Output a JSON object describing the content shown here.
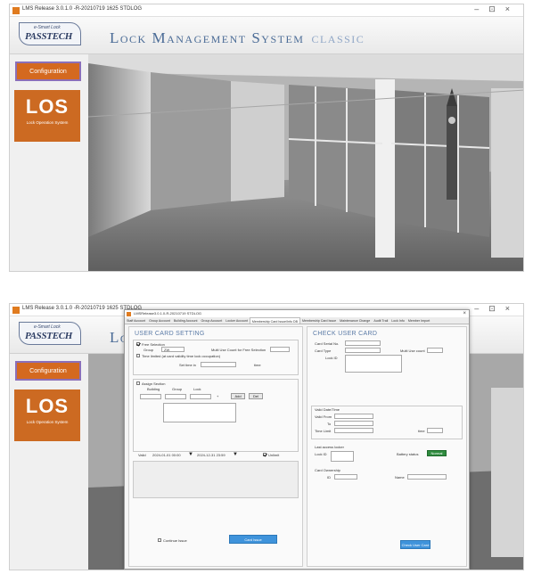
{
  "window": {
    "title": "LMS Release 3.0.1.0 -R-20210719 1625 STDLOG"
  },
  "header": {
    "logo_small": "e-Smart Lock",
    "logo_main": "PASSTECH",
    "app_title": "Lock Management System",
    "edition": "CLASSIC"
  },
  "sidebar": {
    "config_label": "Configuration",
    "los_title": "LOS",
    "los_subtitle": "Lock Operation System"
  },
  "dialog": {
    "title": "LMSRelease3.0.1.0-R-20210719 STDLOG",
    "tabs": [
      "Staff Account",
      "Group Account",
      "Building Account",
      "Group Account",
      "Locker Account",
      "Membership Card Issue/Info DB",
      "Membership Card Issue",
      "Maintenance Change",
      "Audit Trail",
      "Lock Info",
      "Member Import"
    ],
    "active_tab_index": 5,
    "left": {
      "heading": "USER CARD SETTING",
      "free_selection": "Free Selection",
      "group": "Group",
      "group_value": "ZW",
      "multi_use": "Multi Use Count for Free Selection",
      "time_limited": "Time limited (at card validity time lock occupation)",
      "set_time": "Set time in",
      "time_unit": "time",
      "assign_section": "Assign Section",
      "building": "Building",
      "group2": "Group",
      "lock": "Lock",
      "plus": "+",
      "add": "Add",
      "del": "Del",
      "valid": "Valid",
      "valid_from": "2024-01-01 00:00",
      "valid_to": "2024-12-31 23:59",
      "unlimited": "Unlimit",
      "continue_issue": "Continue Issue",
      "card_issue": "Card Issue"
    },
    "right": {
      "heading": "CHECK USER CARD",
      "card_serial": "Card Serial No.",
      "card_type": "Card Type",
      "multi_count": "Multi Use count",
      "lock_id": "Lock ID",
      "valid_date_time": "Valid Date/Time",
      "valid_from": "Valid From",
      "to": "To",
      "time_limit": "Time Limit",
      "time": "time",
      "last_access_lock": "Last access locker",
      "lock_id2": "Lock ID",
      "battery_status": "Battery status",
      "battery_value": "Normal",
      "card_ownership": "Card Ownership",
      "id": "ID",
      "name": "Name",
      "check_user_card": "Check User Card"
    }
  },
  "colors": {
    "accent_orange": "#d4691f",
    "title_blue": "#4a6b96",
    "button_blue": "#3f93db",
    "battery_green": "#2e8b3e"
  }
}
